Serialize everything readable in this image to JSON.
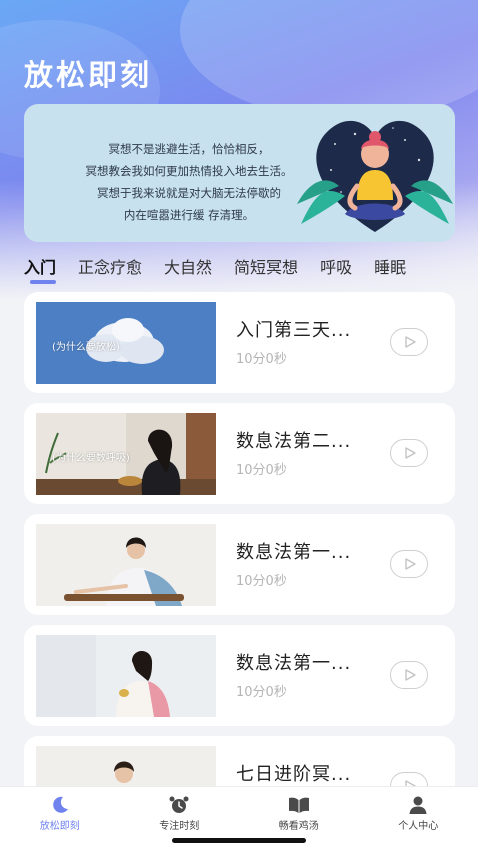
{
  "app": {
    "title": "放松即刻"
  },
  "banner": {
    "lines": [
      "冥想不是逃避生活，恰恰相反，",
      "冥想教会我如何更加热情投入地去生活。",
      "冥想于我来说就是对大脑无法停歇的",
      "内在喧嚣进行缓 存清理。"
    ],
    "colors": {
      "background": "#c8e1ee",
      "heart": "#1e2a4a",
      "shirt": "#f7c531",
      "leaves": "#2bb39a"
    }
  },
  "tabs": [
    {
      "label": "入门",
      "active": true
    },
    {
      "label": "正念疗愈",
      "active": false
    },
    {
      "label": "大自然",
      "active": false
    },
    {
      "label": "简短冥想",
      "active": false
    },
    {
      "label": "呼吸",
      "active": false
    },
    {
      "label": "睡眠",
      "active": false
    }
  ],
  "items": [
    {
      "title": "入门第三天...",
      "duration": "10分0秒",
      "thumb_caption": "(为什么要放松)",
      "thumb_icon": "cloud-sky-icon"
    },
    {
      "title": "数息法第二...",
      "duration": "10分0秒",
      "thumb_caption": "(为什么要数呼吸)",
      "thumb_icon": "woman-singing-bowl-icon"
    },
    {
      "title": "数息法第一...",
      "duration": "10分0秒",
      "thumb_caption": "",
      "thumb_icon": "woman-guqin-icon"
    },
    {
      "title": "数息法第一...",
      "duration": "10分0秒",
      "thumb_caption": "",
      "thumb_icon": "woman-seated-icon"
    },
    {
      "title": "七日进阶冥...",
      "duration": "",
      "thumb_caption": "",
      "thumb_icon": "woman-meditating-icon"
    }
  ],
  "bottom_nav": [
    {
      "label": "放松即刻",
      "icon": "moon-icon",
      "active": true
    },
    {
      "label": "专注时刻",
      "icon": "alarm-clock-icon",
      "active": false
    },
    {
      "label": "畅看鸡汤",
      "icon": "book-icon",
      "active": false
    },
    {
      "label": "个人中心",
      "icon": "person-icon",
      "active": false
    }
  ],
  "colors": {
    "accent": "#6f82ee",
    "header_gradient_start": "#6aa8f5",
    "header_gradient_end": "#a6a6f0"
  }
}
